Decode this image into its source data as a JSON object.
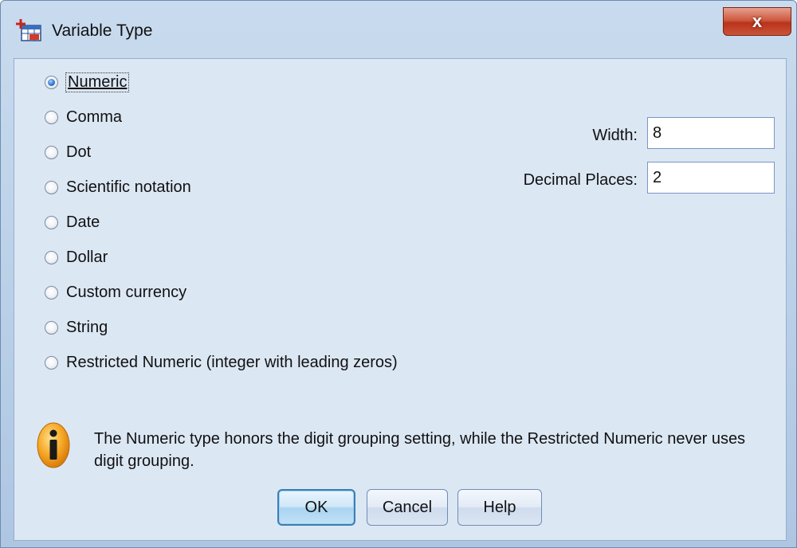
{
  "window": {
    "title": "Variable Type",
    "close_glyph": "x"
  },
  "types": [
    {
      "label": "Numeric",
      "checked": true
    },
    {
      "label": "Comma",
      "checked": false
    },
    {
      "label": "Dot",
      "checked": false
    },
    {
      "label": "Scientific notation",
      "checked": false
    },
    {
      "label": "Date",
      "checked": false
    },
    {
      "label": "Dollar",
      "checked": false
    },
    {
      "label": "Custom currency",
      "checked": false
    },
    {
      "label": "String",
      "checked": false
    },
    {
      "label": "Restricted Numeric (integer with leading zeros)",
      "checked": false
    }
  ],
  "fields": {
    "width_label": "Width:",
    "width_value": "8",
    "decimals_label": "Decimal Places:",
    "decimals_value": "2"
  },
  "info": {
    "text": "The Numeric type honors the digit grouping setting, while the Restricted Numeric never uses digit grouping."
  },
  "buttons": {
    "ok": "OK",
    "cancel": "Cancel",
    "help": "Help"
  },
  "colors": {
    "client_bg": "#dce7f4",
    "close_red": "#c9533a",
    "default_button_border": "#3c7fb1"
  }
}
